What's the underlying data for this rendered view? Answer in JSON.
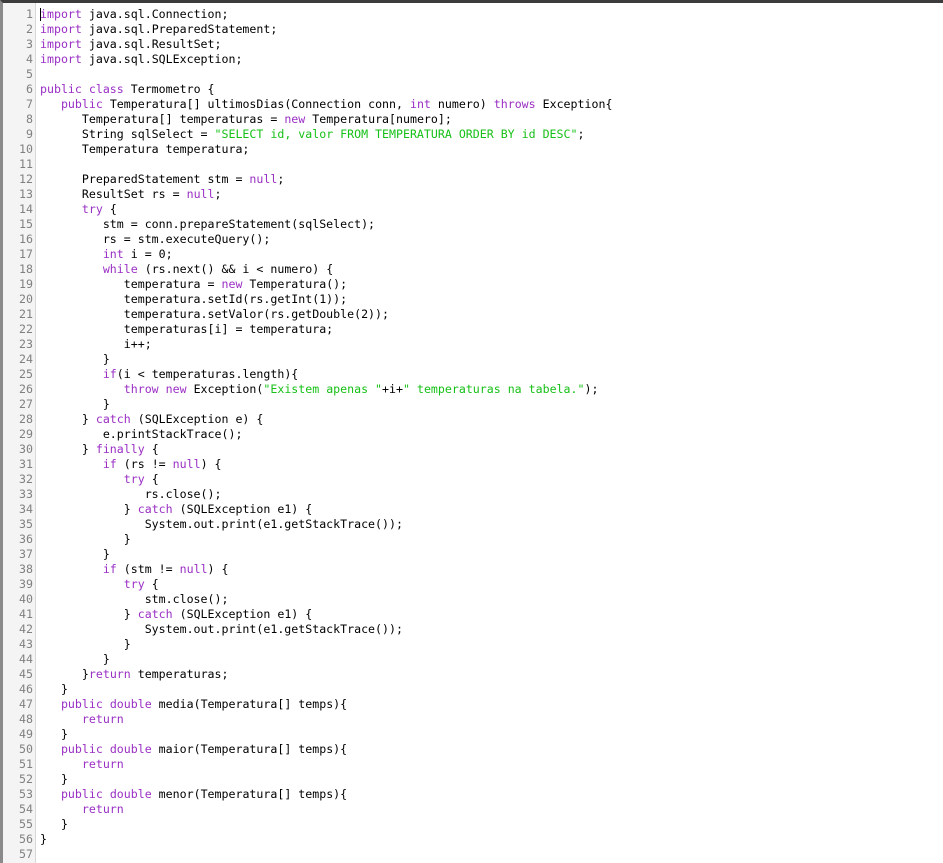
{
  "editor": {
    "colors": {
      "keyword": "#9a2fc4",
      "string": "#16c016",
      "plain": "#000000",
      "line_number": "#808080"
    },
    "lines": [
      [
        [
          "k",
          "import"
        ],
        [
          "p",
          " java.sql.Connection;"
        ]
      ],
      [
        [
          "k",
          "import"
        ],
        [
          "p",
          " java.sql.PreparedStatement;"
        ]
      ],
      [
        [
          "k",
          "import"
        ],
        [
          "p",
          " java.sql.ResultSet;"
        ]
      ],
      [
        [
          "k",
          "import"
        ],
        [
          "p",
          " java.sql.SQLException;"
        ]
      ],
      [],
      [
        [
          "k",
          "public class"
        ],
        [
          "p",
          " Termometro {"
        ]
      ],
      [
        [
          "p",
          "   "
        ],
        [
          "k",
          "public"
        ],
        [
          "p",
          " Temperatura[] ultimosDias(Connection conn, "
        ],
        [
          "k",
          "int"
        ],
        [
          "p",
          " numero) "
        ],
        [
          "k",
          "throws"
        ],
        [
          "p",
          " Exception{"
        ]
      ],
      [
        [
          "p",
          "      Temperatura[] temperaturas = "
        ],
        [
          "k",
          "new"
        ],
        [
          "p",
          " Temperatura[numero];"
        ]
      ],
      [
        [
          "p",
          "      String sqlSelect = "
        ],
        [
          "s",
          "\"SELECT id, valor FROM TEMPERATURA ORDER BY id DESC\""
        ],
        [
          "p",
          ";"
        ]
      ],
      [
        [
          "p",
          "      Temperatura temperatura;"
        ]
      ],
      [],
      [
        [
          "p",
          "      PreparedStatement stm = "
        ],
        [
          "k",
          "null"
        ],
        [
          "p",
          ";"
        ]
      ],
      [
        [
          "p",
          "      ResultSet rs = "
        ],
        [
          "k",
          "null"
        ],
        [
          "p",
          ";"
        ]
      ],
      [
        [
          "p",
          "      "
        ],
        [
          "k",
          "try"
        ],
        [
          "p",
          " {"
        ]
      ],
      [
        [
          "p",
          "         stm = conn.prepareStatement(sqlSelect);"
        ]
      ],
      [
        [
          "p",
          "         rs = stm.executeQuery();"
        ]
      ],
      [
        [
          "p",
          "         "
        ],
        [
          "k",
          "int"
        ],
        [
          "p",
          " i = 0;"
        ]
      ],
      [
        [
          "p",
          "         "
        ],
        [
          "k",
          "while"
        ],
        [
          "p",
          " (rs.next() && i < numero) {"
        ]
      ],
      [
        [
          "p",
          "            temperatura = "
        ],
        [
          "k",
          "new"
        ],
        [
          "p",
          " Temperatura();"
        ]
      ],
      [
        [
          "p",
          "            temperatura.setId(rs.getInt(1));"
        ]
      ],
      [
        [
          "p",
          "            temperatura.setValor(rs.getDouble(2));"
        ]
      ],
      [
        [
          "p",
          "            temperaturas[i] = temperatura;"
        ]
      ],
      [
        [
          "p",
          "            i++;"
        ]
      ],
      [
        [
          "p",
          "         }"
        ]
      ],
      [
        [
          "p",
          "         "
        ],
        [
          "k",
          "if"
        ],
        [
          "p",
          "(i < temperaturas.length){"
        ]
      ],
      [
        [
          "p",
          "            "
        ],
        [
          "k",
          "throw new"
        ],
        [
          "p",
          " Exception("
        ],
        [
          "s",
          "\"Existem apenas \""
        ],
        [
          "p",
          "+i+"
        ],
        [
          "s",
          "\" temperaturas na tabela.\""
        ],
        [
          "p",
          ");"
        ]
      ],
      [
        [
          "p",
          "         }"
        ]
      ],
      [
        [
          "p",
          "      } "
        ],
        [
          "k",
          "catch"
        ],
        [
          "p",
          " (SQLException e) {"
        ]
      ],
      [
        [
          "p",
          "         e.printStackTrace();"
        ]
      ],
      [
        [
          "p",
          "      } "
        ],
        [
          "k",
          "finally"
        ],
        [
          "p",
          " {"
        ]
      ],
      [
        [
          "p",
          "         "
        ],
        [
          "k",
          "if"
        ],
        [
          "p",
          " (rs != "
        ],
        [
          "k",
          "null"
        ],
        [
          "p",
          ") {"
        ]
      ],
      [
        [
          "p",
          "            "
        ],
        [
          "k",
          "try"
        ],
        [
          "p",
          " {"
        ]
      ],
      [
        [
          "p",
          "               rs.close();"
        ]
      ],
      [
        [
          "p",
          "            } "
        ],
        [
          "k",
          "catch"
        ],
        [
          "p",
          " (SQLException e1) {"
        ]
      ],
      [
        [
          "p",
          "               System.out.print(e1.getStackTrace());"
        ]
      ],
      [
        [
          "p",
          "            }"
        ]
      ],
      [
        [
          "p",
          "         }"
        ]
      ],
      [
        [
          "p",
          "         "
        ],
        [
          "k",
          "if"
        ],
        [
          "p",
          " (stm != "
        ],
        [
          "k",
          "null"
        ],
        [
          "p",
          ") {"
        ]
      ],
      [
        [
          "p",
          "            "
        ],
        [
          "k",
          "try"
        ],
        [
          "p",
          " {"
        ]
      ],
      [
        [
          "p",
          "               stm.close();"
        ]
      ],
      [
        [
          "p",
          "            } "
        ],
        [
          "k",
          "catch"
        ],
        [
          "p",
          " (SQLException e1) {"
        ]
      ],
      [
        [
          "p",
          "               System.out.print(e1.getStackTrace());"
        ]
      ],
      [
        [
          "p",
          "            }"
        ]
      ],
      [
        [
          "p",
          "         }"
        ]
      ],
      [
        [
          "p",
          "      }"
        ],
        [
          "k",
          "return"
        ],
        [
          "p",
          " temperaturas;"
        ]
      ],
      [
        [
          "p",
          "   }"
        ]
      ],
      [
        [
          "p",
          "   "
        ],
        [
          "k",
          "public double"
        ],
        [
          "p",
          " media(Temperatura[] temps){"
        ]
      ],
      [
        [
          "p",
          "      "
        ],
        [
          "k",
          "return"
        ]
      ],
      [
        [
          "p",
          "   }"
        ]
      ],
      [
        [
          "p",
          "   "
        ],
        [
          "k",
          "public double"
        ],
        [
          "p",
          " maior(Temperatura[] temps){"
        ]
      ],
      [
        [
          "p",
          "      "
        ],
        [
          "k",
          "return"
        ]
      ],
      [
        [
          "p",
          "   }"
        ]
      ],
      [
        [
          "p",
          "   "
        ],
        [
          "k",
          "public double"
        ],
        [
          "p",
          " menor(Temperatura[] temps){"
        ]
      ],
      [
        [
          "p",
          "      "
        ],
        [
          "k",
          "return"
        ]
      ],
      [
        [
          "p",
          "   }"
        ]
      ],
      [
        [
          "p",
          "}"
        ]
      ],
      []
    ]
  }
}
